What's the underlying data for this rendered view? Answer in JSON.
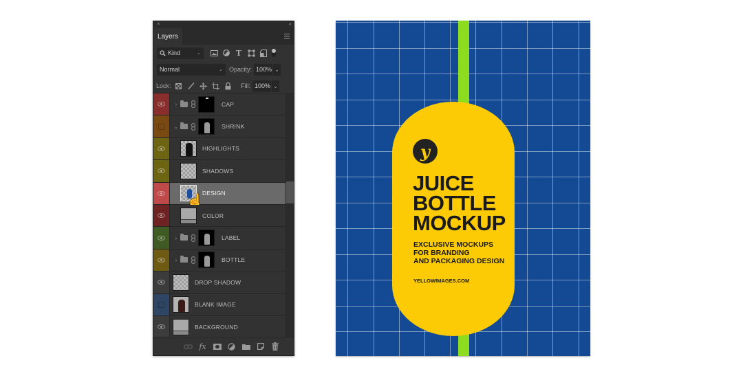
{
  "panel": {
    "close_glyph": "×",
    "collapse_glyph": "‹‹",
    "tab_label": "Layers",
    "filter": {
      "kind_label": "Kind",
      "icons": [
        "pixel-filter-icon",
        "adjustment-filter-icon",
        "type-filter-icon",
        "shape-filter-icon",
        "smart-object-filter-icon"
      ]
    },
    "blend_mode": "Normal",
    "opacity_label": "Opacity:",
    "opacity_value": "100%",
    "lock_label": "Lock:",
    "fill_label": "Fill:",
    "fill_value": "100%",
    "layers": [
      {
        "name": "CAP",
        "color": "#8a2d2d",
        "visible": true,
        "group": true,
        "expanded": false,
        "thumb": "black-cap",
        "indent": 0
      },
      {
        "name": "SHRINK",
        "color": "#7a4a12",
        "visible": false,
        "group": true,
        "expanded": true,
        "thumb": "black-bottle",
        "indent": 0
      },
      {
        "name": "HIGHLIGHTS",
        "color": "#6e6512",
        "visible": true,
        "group": false,
        "thumb": "checker-dark-bottle",
        "indent": 1
      },
      {
        "name": "SHADOWS",
        "color": "#6e6512",
        "visible": true,
        "group": false,
        "thumb": "checker",
        "indent": 1
      },
      {
        "name": "DESIGN",
        "color": "#c04a4a",
        "visible": true,
        "group": false,
        "thumb": "checker-design",
        "indent": 1,
        "selected": true
      },
      {
        "name": "COLOR",
        "color": "#6e2222",
        "visible": true,
        "group": false,
        "thumb": "gray",
        "indent": 1
      },
      {
        "name": "LABEL",
        "color": "#3f5a22",
        "visible": true,
        "group": true,
        "expanded": false,
        "thumb": "black-bottle",
        "indent": 0
      },
      {
        "name": "BOTTLE",
        "color": "#6e5a12",
        "visible": true,
        "group": true,
        "expanded": false,
        "thumb": "black-bottle",
        "indent": 0
      },
      {
        "name": "DROP SHADOW",
        "color": "#3c3c3c",
        "visible": true,
        "group": false,
        "thumb": "checker",
        "indent": -1
      },
      {
        "name": "BLANK IMAGE",
        "color": "#2e4664",
        "visible": false,
        "group": false,
        "thumb": "brown-bottle",
        "indent": -1
      },
      {
        "name": "BACKGROUND",
        "color": "#3c3c3c",
        "visible": true,
        "group": false,
        "thumb": "gray",
        "indent": -1
      }
    ],
    "bottom_icons": {
      "link": "⊖",
      "fx": "fx",
      "mask": "◙",
      "adjustment": "◐",
      "folder": "▬",
      "new": "❐",
      "trash": "🗑"
    }
  },
  "artwork": {
    "colors": {
      "background": "#134a93",
      "stripe": "#8edc1f",
      "label": "#fdcb05",
      "text": "#1a1a1a"
    },
    "logo_glyph": "y",
    "headline": [
      "JUICE",
      "BOTTLE",
      "MOCKUP"
    ],
    "subheading": [
      "EXCLUSIVE MOCKUPS",
      "FOR BRANDING",
      "AND PACKAGING DESIGN"
    ],
    "url": "YELLOWIMAGES.COM"
  }
}
